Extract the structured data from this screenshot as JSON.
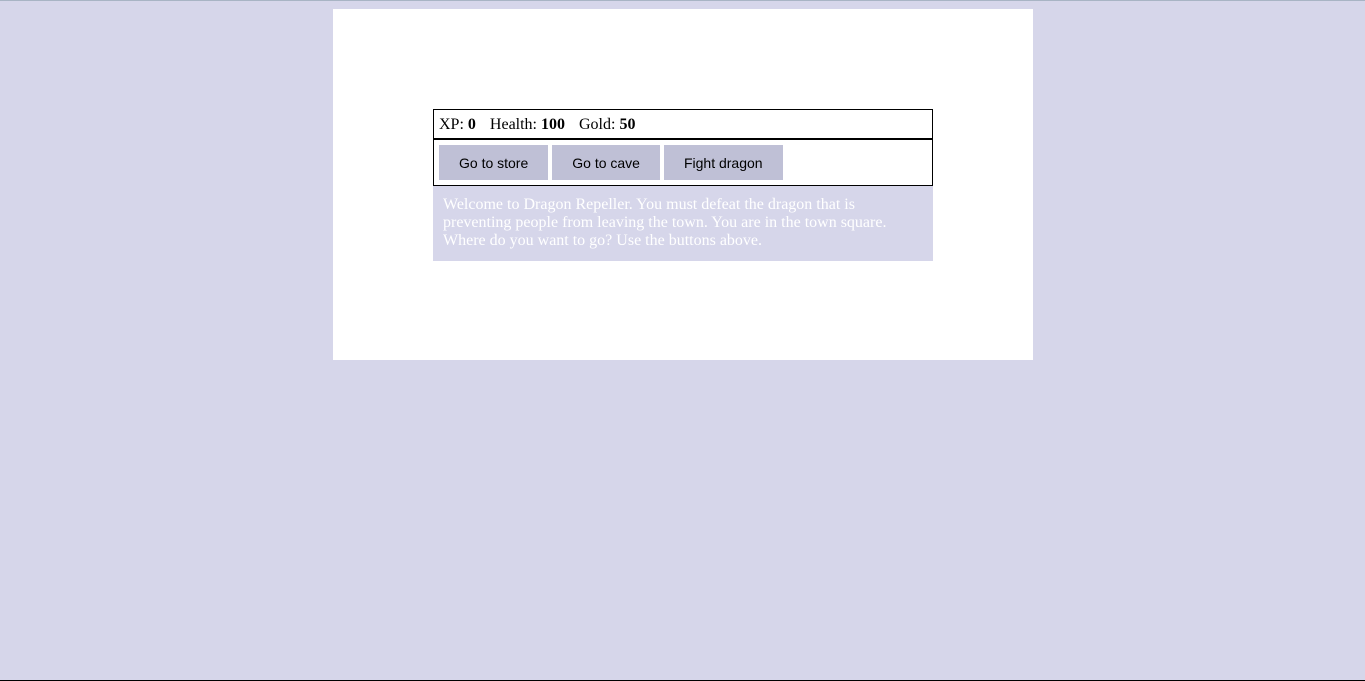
{
  "stats": {
    "xp_label": "XP:",
    "xp_value": "0",
    "health_label": "Health:",
    "health_value": "100",
    "gold_label": "Gold:",
    "gold_value": "50"
  },
  "controls": {
    "button1_label": "Go to store",
    "button2_label": "Go to cave",
    "button3_label": "Fight dragon"
  },
  "text": "Welcome to Dragon Repeller. You must defeat the dragon that is preventing people from leaving the town. You are in the town square. Where do you want to go? Use the buttons above.",
  "colors": {
    "page_background": "#d6d6ea",
    "container_background": "#ffffff",
    "button_background": "#bfc0d6",
    "text_background": "#d6d6ea",
    "text_color": "#ffffff"
  }
}
